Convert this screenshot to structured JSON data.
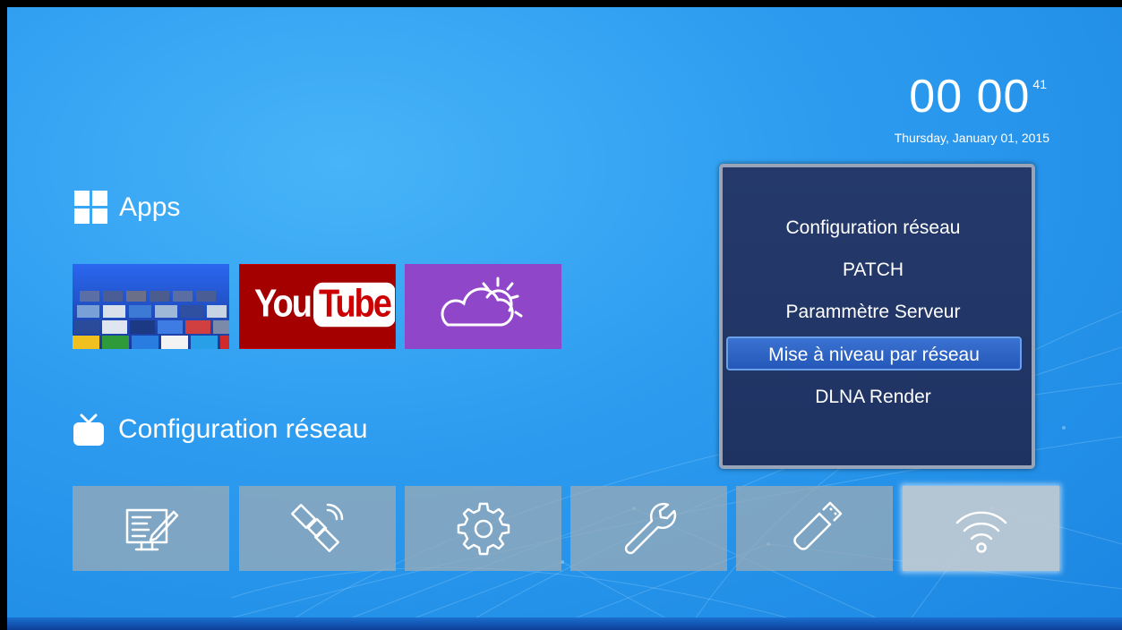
{
  "clock": {
    "time": "00 00",
    "seconds": "41",
    "date": "Thursday, January 01, 2015"
  },
  "apps_section": {
    "title": "Apps",
    "icon": "apps-grid-icon"
  },
  "apps": [
    {
      "name": "app-mosaic",
      "icon": "app-grid-mosaic-icon"
    },
    {
      "name": "youtube",
      "label_you": "You",
      "label_tube": "Tube",
      "color": "#a50000"
    },
    {
      "name": "weather",
      "icon": "weather-cloud-sun-icon",
      "color": "#9046c9"
    }
  ],
  "settings_section": {
    "title": "Configuration réseau",
    "icon": "tv-icon"
  },
  "toolbar": [
    {
      "icon": "document-edit-icon"
    },
    {
      "icon": "satellite-icon"
    },
    {
      "icon": "gear-icon"
    },
    {
      "icon": "wrench-icon"
    },
    {
      "icon": "usb-drive-icon"
    },
    {
      "icon": "wifi-icon",
      "selected": true
    }
  ],
  "menu": {
    "items": [
      "Configuration réseau",
      "PATCH",
      "Parammètre Serveur",
      "Mise à niveau par réseau",
      "DLNA Render"
    ],
    "selected": "Mise à niveau par réseau"
  },
  "colors": {
    "menu_bg": "#253a6b",
    "highlight": "#2f66c6",
    "background": "#2c9bef"
  }
}
